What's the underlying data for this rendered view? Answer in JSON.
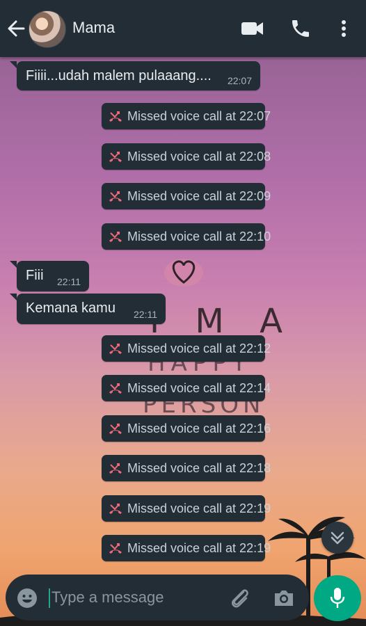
{
  "header": {
    "contact_name": "Mama"
  },
  "messages": [
    {
      "text": "Fiiii...udah malem pulaaang....",
      "time": "22:07"
    },
    {
      "text": "Fiii",
      "time": "22:11"
    },
    {
      "text": "Kemana kamu",
      "time": "22:11"
    }
  ],
  "missed_calls": [
    "Missed voice call at 22:07",
    "Missed voice call at 22:08",
    "Missed voice call at 22:09",
    "Missed voice call at 22:10",
    "Missed voice call at 22:12",
    "Missed voice call at 22:14",
    "Missed voice call at 22:16",
    "Missed voice call at 22:18",
    "Missed voice call at 22:19",
    "Missed voice call at 22:19"
  ],
  "composer": {
    "placeholder": "Type a message"
  },
  "colors": {
    "bar": "#232d36",
    "accent": "#00a884",
    "missed_call_icon": "#f06a7a"
  },
  "icons": {
    "back": "arrow-left",
    "video": "videocam",
    "call": "phone",
    "menu": "more-vertical",
    "missed": "call-missed",
    "scroll": "chevron-double-down",
    "emoji": "emoji",
    "attach": "paperclip",
    "camera": "camera",
    "mic": "microphone"
  },
  "wallpaper": {
    "text_lines": [
      "I M A",
      "HAPPY",
      "PERSON"
    ]
  }
}
